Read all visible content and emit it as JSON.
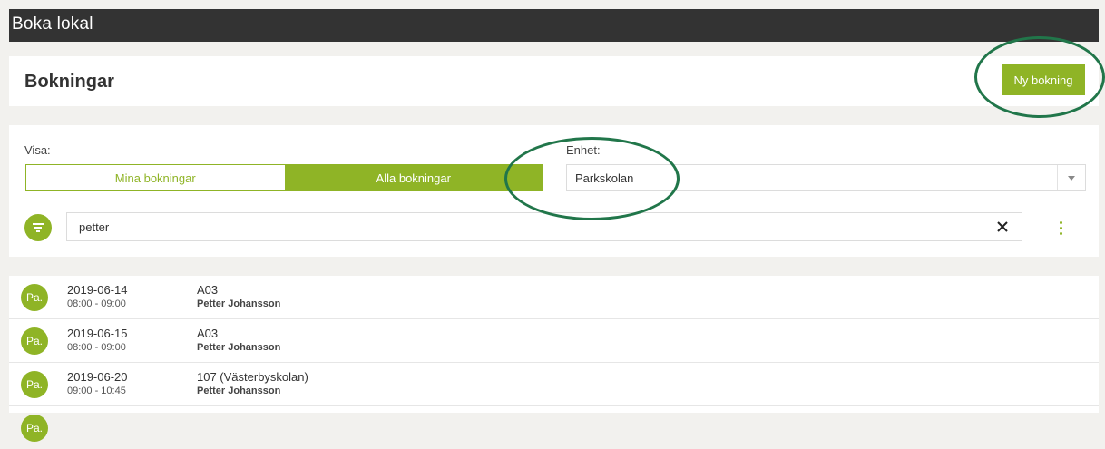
{
  "app": {
    "title": "Boka lokal"
  },
  "header": {
    "title": "Bokningar",
    "new_booking_label": "Ny bokning"
  },
  "filters": {
    "show_label": "Visa:",
    "tabs": [
      {
        "label": "Mina bokningar",
        "active": false
      },
      {
        "label": "Alla bokningar",
        "active": true
      }
    ],
    "unit_label": "Enhet:",
    "unit_value": "Parkskolan",
    "search_value": "petter"
  },
  "icons": {
    "filter": "filter-icon",
    "clear": "close-icon",
    "more": "kebab-menu-icon",
    "dropdown": "chevron-down-icon"
  },
  "colors": {
    "accent": "#8fb426",
    "topbar": "#333333",
    "annotation": "#21764a"
  },
  "bookings": [
    {
      "avatar": "Pa.",
      "date": "2019-06-14",
      "time": "08:00 - 09:00",
      "room": "A03",
      "person": "Petter Johansson"
    },
    {
      "avatar": "Pa.",
      "date": "2019-06-15",
      "time": "08:00 - 09:00",
      "room": "A03",
      "person": "Petter Johansson"
    },
    {
      "avatar": "Pa.",
      "date": "2019-06-20",
      "time": "09:00 - 10:45",
      "room": "107 (Västerbyskolan)",
      "person": "Petter Johansson"
    },
    {
      "avatar": "Pa.",
      "date": "",
      "time": "",
      "room": "",
      "person": ""
    }
  ]
}
